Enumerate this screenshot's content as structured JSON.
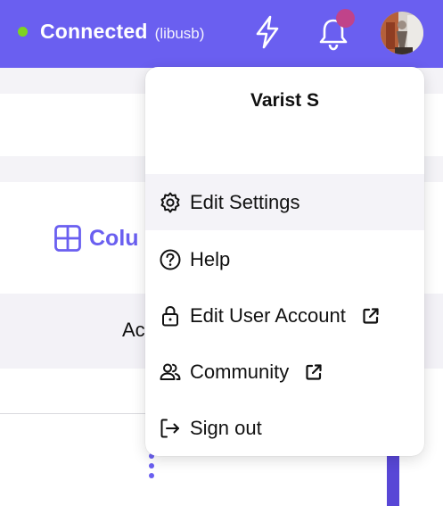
{
  "header": {
    "status_label": "Connected",
    "status_detail": "(libusb)",
    "status_color": "#7ed321",
    "bar_color": "#6a5ff0",
    "icons": [
      "lightning-icon",
      "bell-icon",
      "avatar"
    ]
  },
  "background": {
    "columns_label": "Colu",
    "ac_text": "Ac"
  },
  "user_menu": {
    "user_name": "Varist S",
    "items": [
      {
        "label": "Edit Settings",
        "icon": "gear-icon",
        "external": false
      },
      {
        "label": "Help",
        "icon": "help-circle-icon",
        "external": false
      },
      {
        "label": "Edit User Account",
        "icon": "lock-icon",
        "external": true
      },
      {
        "label": "Community",
        "icon": "users-icon",
        "external": true
      },
      {
        "label": "Sign out",
        "icon": "sign-out-icon",
        "external": false
      }
    ]
  }
}
